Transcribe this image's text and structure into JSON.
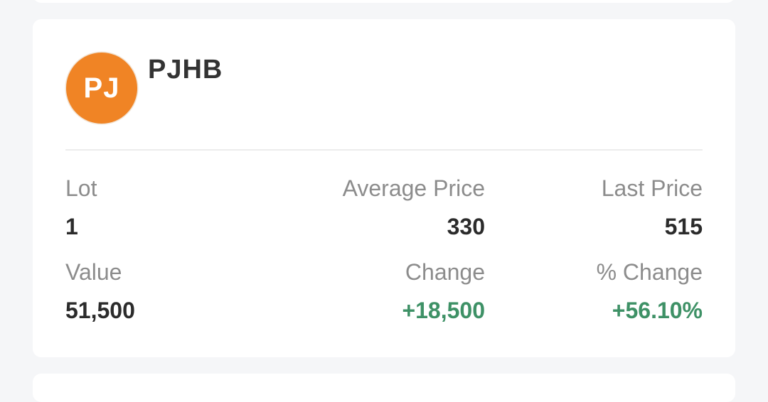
{
  "holding": {
    "avatar_initials": "PJ",
    "avatar_color": "#f08425",
    "ticker": "PJHB",
    "positive_color": "#3e9166",
    "stats": {
      "lot_label": "Lot",
      "lot_value": "1",
      "average_price_label": "Average Price",
      "average_price_value": "330",
      "last_price_label": "Last Price",
      "last_price_value": "515",
      "value_label": "Value",
      "value_value": "51,500",
      "change_label": "Change",
      "change_value": "+18,500",
      "pct_change_label": "% Change",
      "pct_change_value": "+56.10%"
    }
  }
}
